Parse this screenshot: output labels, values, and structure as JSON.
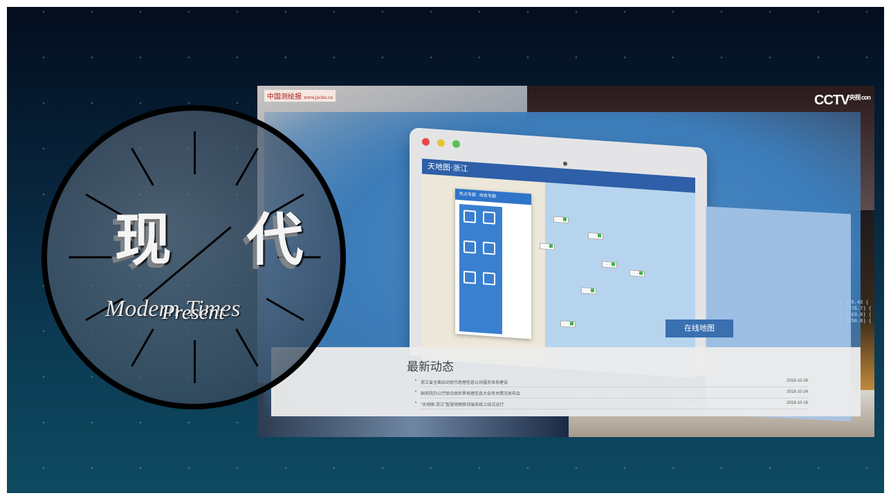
{
  "video": {
    "source_logo": "中国测绘报",
    "source_logo_url": "www.jache.cn",
    "channel_logo": "CCTV",
    "channel_logo_sub": "央视 con",
    "ticker": [
      "( 436.43 (",
      "( 1376.7) (",
      "( 1163.0) (",
      "( 1550.8) ("
    ]
  },
  "laptop": {
    "map_site_title": "天地图·浙江",
    "menu_tabs": [
      "热点专题",
      "综合专题"
    ],
    "map_button": "在线地图"
  },
  "news": {
    "title": "最新动态",
    "items": [
      {
        "text": "浙江省全面启动现代地理信息公共服务体系建设",
        "date": "2018-10-26"
      },
      {
        "text": "国务院办公厅联合国世界地理信息大会有关情况发布会",
        "date": "2018-10-24"
      },
      {
        "text": "\"天地图·浙江\"智慧地图移动端系统上线试运行",
        "date": "2018-10-16"
      }
    ]
  },
  "overlay": {
    "title_cn": "现  代",
    "title_en_1": "Modern Times",
    "title_en_2": "Present"
  },
  "colors": {
    "background_top": "#040d1e",
    "background_bottom": "#0d4a60",
    "screen_blue": "#3c7cb9",
    "map_header": "#2e5fa8"
  }
}
